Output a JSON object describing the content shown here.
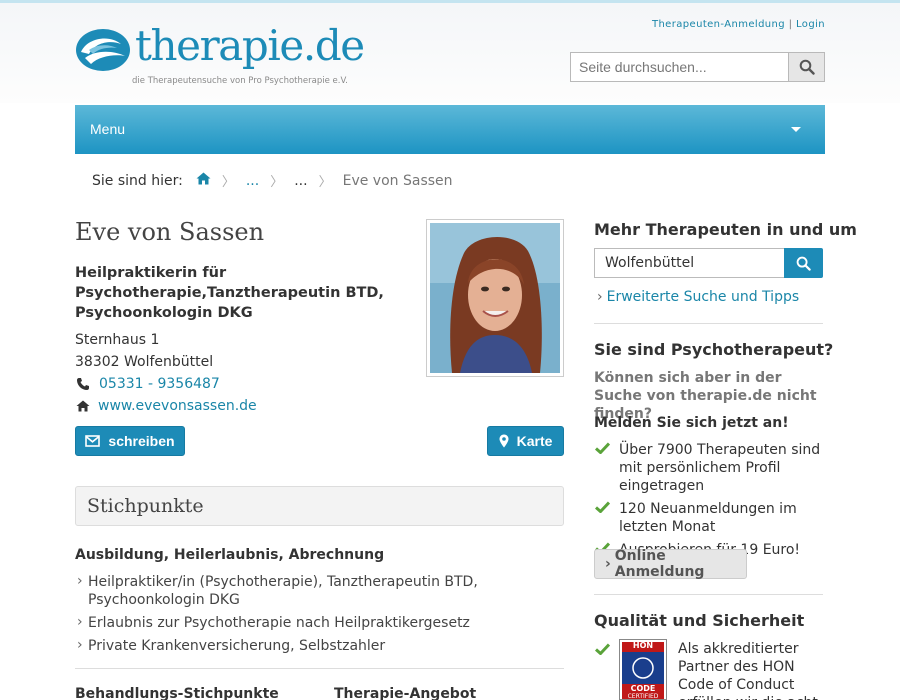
{
  "header": {
    "logo_text": "therapie.de",
    "logo_subtitle": "die Therapeutensuche von Pro Psychotherapie e.V.",
    "links": {
      "register": "Therapeuten-Anmeldung",
      "separator": "|",
      "login": "Login"
    },
    "search": {
      "placeholder": "Seite durchsuchen...",
      "icon": "search-icon"
    }
  },
  "nav": {
    "menu_label": "Menu",
    "icon": "chevron-down-icon"
  },
  "breadcrumb": {
    "label": "Sie sind hier:",
    "home_icon": "home-icon",
    "items": [
      "...",
      "..."
    ],
    "current": "Eve von Sassen"
  },
  "profile": {
    "name": "Eve von Sassen",
    "profession": "Heilpraktikerin für Psychotherapie,Tanztherapeutin BTD, Psychoonkologin DKG",
    "street": "Sternhaus 1",
    "city": "38302 Wolfenbüttel",
    "phone": "05331 - 9356487",
    "website": "www.evevonsassen.de",
    "buttons": {
      "write": "schreiben",
      "map": "Karte"
    }
  },
  "stichpunkte": {
    "title": "Stichpunkte",
    "education_heading": "Ausbildung, Heilerlaubnis, Abrechnung",
    "education_items": [
      "Heilpraktiker/in (Psychotherapie), Tanztherapeutin BTD, Psychoonkologin DKG",
      "Erlaubnis zur Psychotherapie nach Heilpraktikergesetz",
      "Private Krankenversicherung, Selbstzahler"
    ],
    "focus_heading": "Behandlungs-Stichpunkte",
    "offer_heading": "Therapie-Angebot"
  },
  "sidebar": {
    "more_title": "Mehr Therapeuten in und um",
    "location_value": "Wolfenbüttel",
    "advanced_link": "Erweiterte Suche und Tipps",
    "therapist_title": "Sie sind Psychotherapeut?",
    "therapist_question": "Können sich aber in der Suche von therapie.de nicht finden?",
    "register_cta": "Melden Sie sich jetzt an!",
    "benefits": [
      "Über 7900 Therapeuten sind mit persönlichem Profil eingetragen",
      "120 Neuanmeldungen im letzten Monat",
      "Ausprobieren für 19 Euro!"
    ],
    "online_button": "Online Anmeldung",
    "quality_title": "Qualität und Sicherheit",
    "hon_text": "Als akkreditierter Partner des HON Code of Conduct erfüllen wir die acht Prinzipien für",
    "hon_badge": {
      "line1": "HON",
      "line2": "CODE",
      "line3": "CERTIFIED"
    }
  },
  "colors": {
    "brand": "#1d8bb7",
    "nav_top": "#5cb8d8",
    "nav_bottom": "#1d94c3",
    "check_green": "#5aa33a"
  }
}
